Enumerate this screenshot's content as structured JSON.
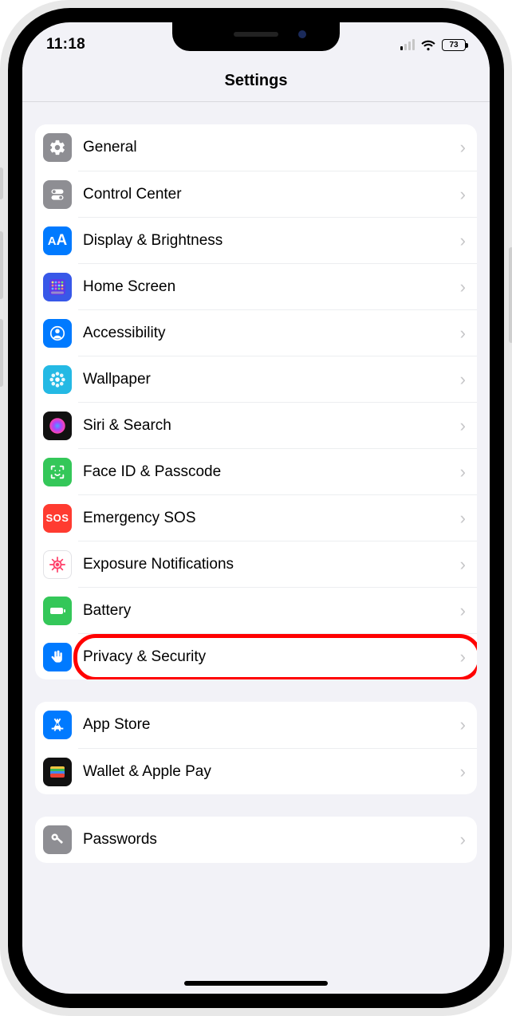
{
  "status": {
    "time": "11:18",
    "battery_pct": "73"
  },
  "header": {
    "title": "Settings"
  },
  "groups": [
    {
      "rows": [
        {
          "id": "general",
          "label": "General",
          "icon": "gear",
          "bg": "bg-gray"
        },
        {
          "id": "control-center",
          "label": "Control Center",
          "icon": "toggles",
          "bg": "bg-gray2"
        },
        {
          "id": "display",
          "label": "Display & Brightness",
          "icon": "aa",
          "bg": "bg-blue"
        },
        {
          "id": "home-screen",
          "label": "Home Screen",
          "icon": "grid",
          "bg": "bg-indigo"
        },
        {
          "id": "accessibility",
          "label": "Accessibility",
          "icon": "person",
          "bg": "bg-blue"
        },
        {
          "id": "wallpaper",
          "label": "Wallpaper",
          "icon": "flower",
          "bg": "bg-cyan"
        },
        {
          "id": "siri",
          "label": "Siri & Search",
          "icon": "siri",
          "bg": "bg-black"
        },
        {
          "id": "faceid",
          "label": "Face ID & Passcode",
          "icon": "face",
          "bg": "bg-green"
        },
        {
          "id": "sos",
          "label": "Emergency SOS",
          "icon": "sos",
          "bg": "bg-red"
        },
        {
          "id": "exposure",
          "label": "Exposure Notifications",
          "icon": "virus",
          "bg": "bg-white"
        },
        {
          "id": "battery",
          "label": "Battery",
          "icon": "battery",
          "bg": "bg-green"
        },
        {
          "id": "privacy",
          "label": "Privacy & Security",
          "icon": "hand",
          "bg": "bg-blue",
          "highlight": true
        }
      ]
    },
    {
      "rows": [
        {
          "id": "app-store",
          "label": "App Store",
          "icon": "appstore",
          "bg": "bg-blue"
        },
        {
          "id": "wallet",
          "label": "Wallet & Apple Pay",
          "icon": "wallet",
          "bg": "bg-black"
        }
      ]
    },
    {
      "rows": [
        {
          "id": "passwords",
          "label": "Passwords",
          "icon": "key",
          "bg": "bg-gray"
        }
      ]
    }
  ]
}
